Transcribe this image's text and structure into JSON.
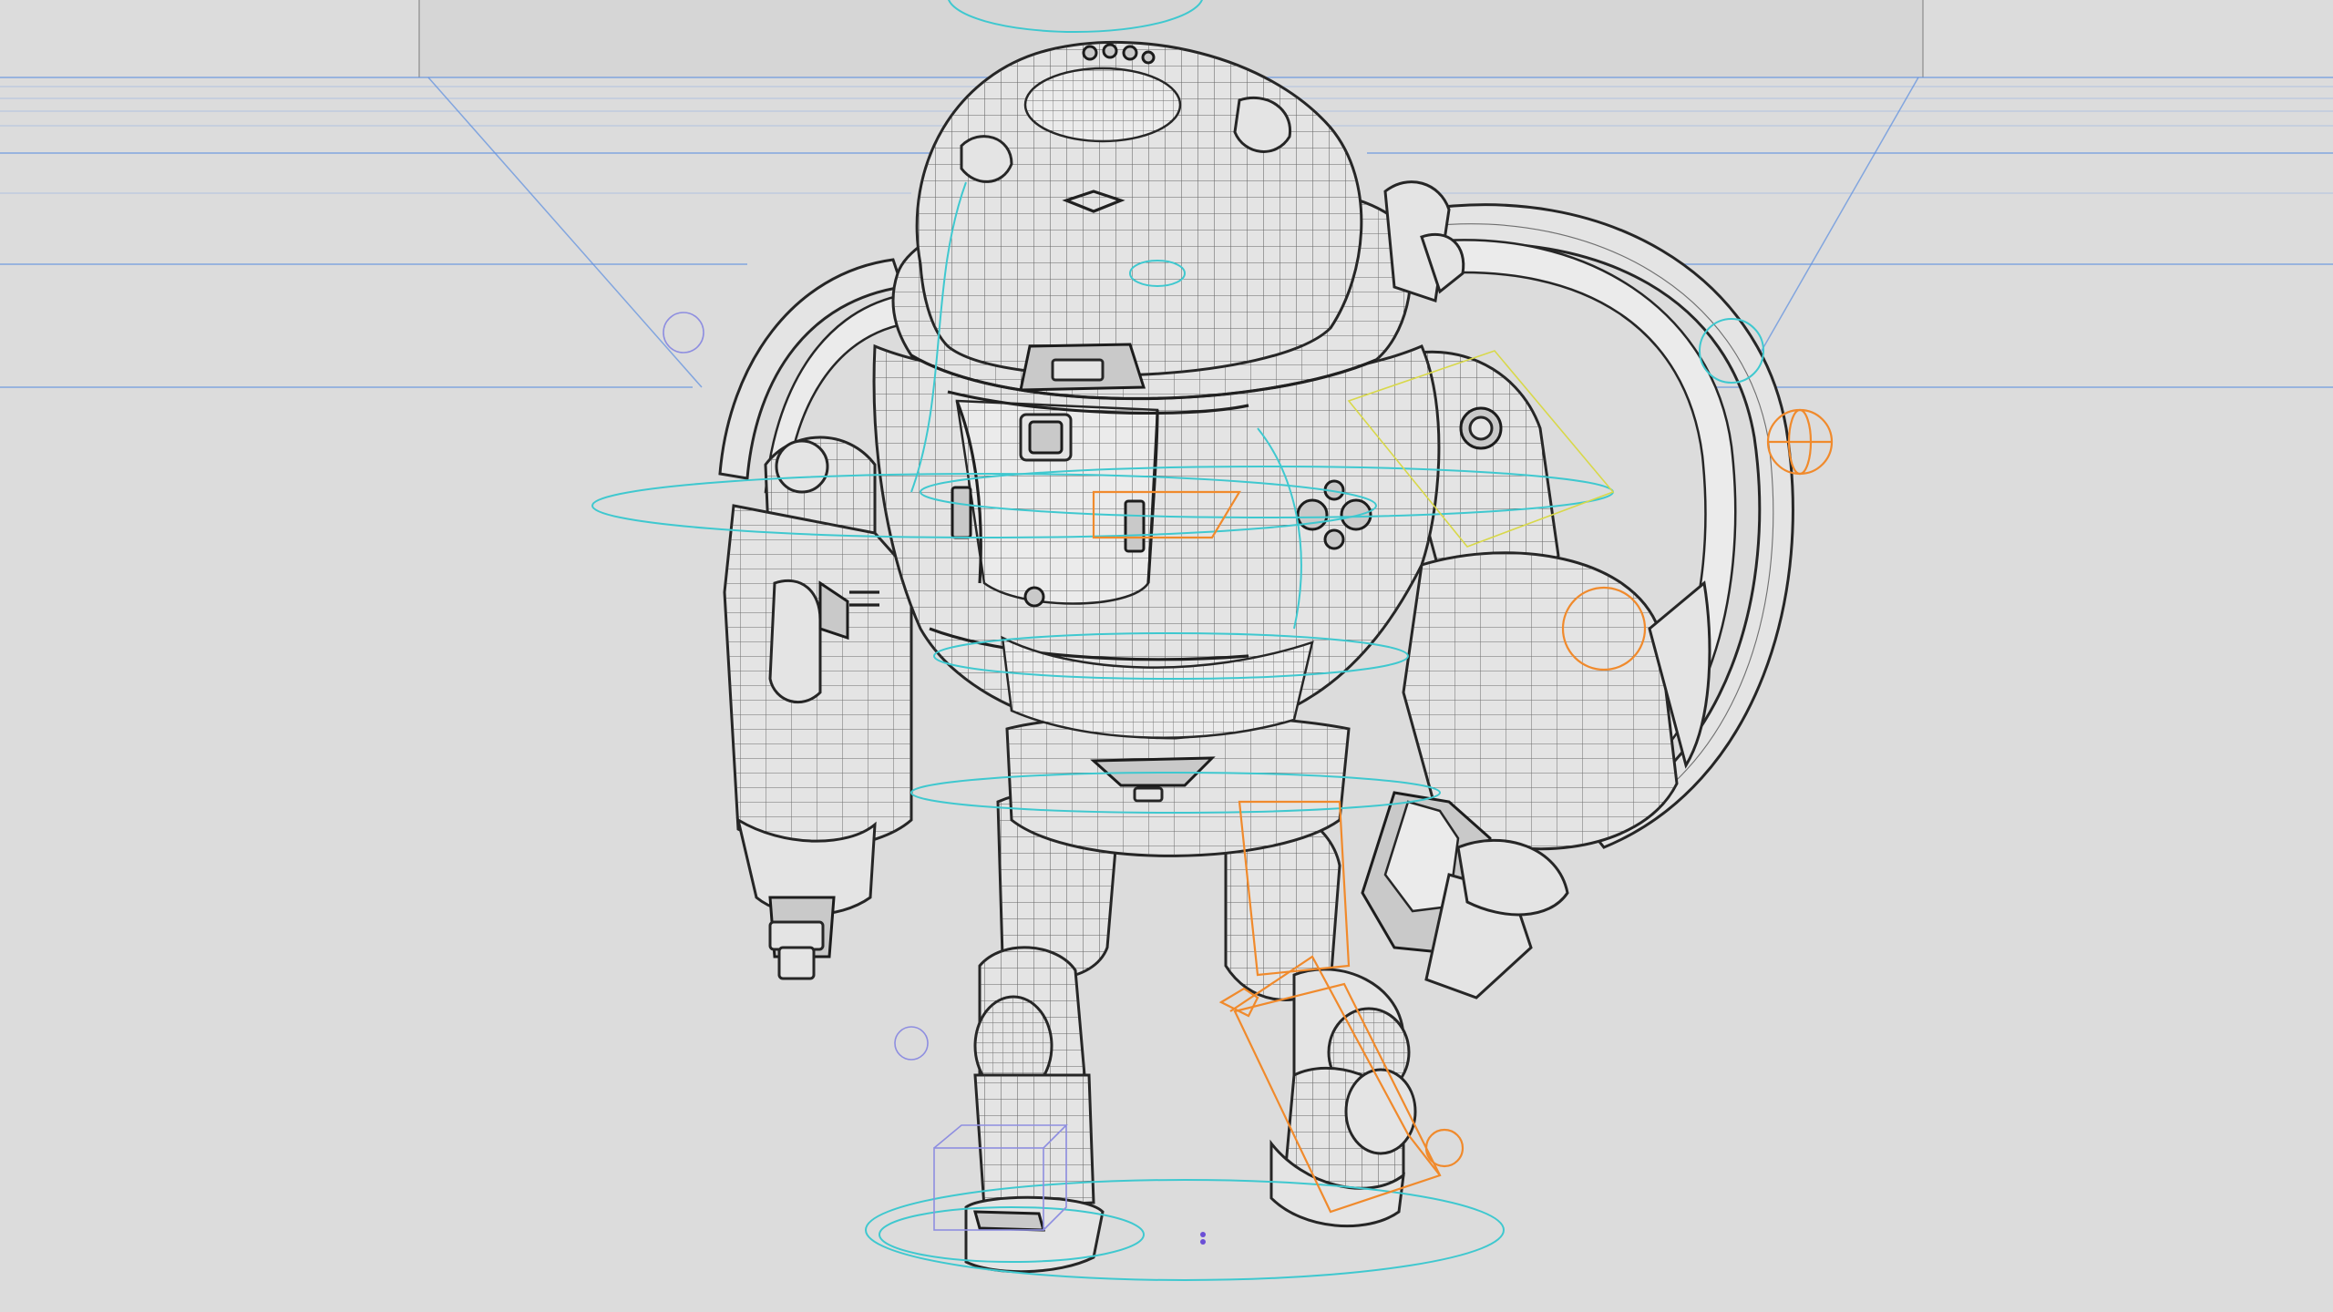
{
  "viewport": {
    "mode": "wireframe-on-shaded",
    "colors": {
      "background": "#dcdcdc",
      "mesh_fill": "#e4e4e4",
      "mesh_edge": "#262626",
      "grid": "#5c8fe0",
      "control_ik": "#f08a2c",
      "control_fk": "#3fc8cf",
      "control_misc": "#8e8ee0"
    },
    "icons": [
      "robot-mesh",
      "rig-controls"
    ]
  }
}
